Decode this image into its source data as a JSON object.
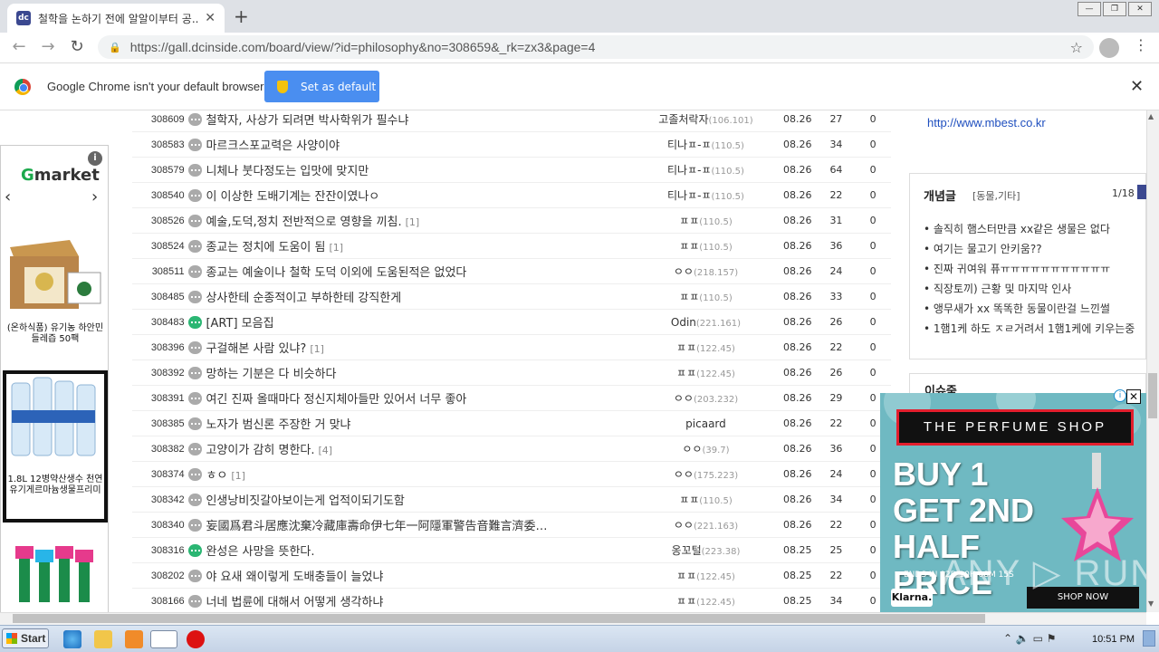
{
  "browser": {
    "tab_title": "철학을 논하기 전에 알알이부터 공...",
    "tab_close": "✕",
    "new_tab": "+",
    "url": "https://gall.dcinside.com/board/view/?id=philosophy&no=308659&_rk=zx3&page=4",
    "win_buttons": [
      "—",
      "❐",
      "✕"
    ]
  },
  "infobar": {
    "text": "Google Chrome isn't your default browser",
    "button": "Set as default",
    "close": "✕"
  },
  "left_ad": {
    "brand": "Gmarket",
    "prev": "‹",
    "next": "›",
    "info": "i",
    "products": [
      "(온하식품) 유기농 하안민들레즙 50팩",
      "1.8L 12병약산생수 천연유기게르마늄생물프리미"
    ]
  },
  "posts": [
    {
      "no": "308609",
      "icon": "text",
      "subject": "철학자, 사상가 되려면 박사학위가 필수냐",
      "comments": "",
      "writer": "고졸처락자",
      "ip": "(106.101)",
      "date": "08.26",
      "hits": "27",
      "rec": "0"
    },
    {
      "no": "308583",
      "icon": "text",
      "subject": "마르크스포교력은 사양이야",
      "comments": "",
      "writer": "티나ㅍ-ㅍ",
      "ip": "(110.5)",
      "date": "08.26",
      "hits": "34",
      "rec": "0"
    },
    {
      "no": "308579",
      "icon": "text",
      "subject": "니체나 붓다정도는 입맛에 맞지만",
      "comments": "",
      "writer": "티나ㅍ-ㅍ",
      "ip": "(110.5)",
      "date": "08.26",
      "hits": "64",
      "rec": "0"
    },
    {
      "no": "308540",
      "icon": "text",
      "subject": "이 이상한 도배기계는 잔잔이였나ㅇ",
      "comments": "",
      "writer": "티나ㅍ-ㅍ",
      "ip": "(110.5)",
      "date": "08.26",
      "hits": "22",
      "rec": "0"
    },
    {
      "no": "308526",
      "icon": "text",
      "subject": "예술,도덕,정치 전반적으로 영향을 끼침.",
      "comments": "[1]",
      "writer": "ㅍㅍ",
      "ip": "(110.5)",
      "date": "08.26",
      "hits": "31",
      "rec": "0"
    },
    {
      "no": "308524",
      "icon": "text",
      "subject": "종교는 정치에 도움이 됨",
      "comments": "[1]",
      "writer": "ㅍㅍ",
      "ip": "(110.5)",
      "date": "08.26",
      "hits": "36",
      "rec": "0"
    },
    {
      "no": "308511",
      "icon": "text",
      "subject": "종교는 예술이나 철학 도덕 이외에 도움된적은 없었다",
      "comments": "",
      "writer": "ㅇㅇ",
      "ip": "(218.157)",
      "date": "08.26",
      "hits": "24",
      "rec": "0"
    },
    {
      "no": "308485",
      "icon": "text",
      "subject": "상사한테 순종적이고 부하한테 강직한게",
      "comments": "",
      "writer": "ㅍㅍ",
      "ip": "(110.5)",
      "date": "08.26",
      "hits": "33",
      "rec": "0"
    },
    {
      "no": "308483",
      "icon": "picture",
      "subject": "[ART] 모음집",
      "comments": "",
      "writer": "Odin",
      "ip": "(221.161)",
      "date": "08.26",
      "hits": "26",
      "rec": "0"
    },
    {
      "no": "308396",
      "icon": "text",
      "subject": "구걸해본 사람 있냐?",
      "comments": "[1]",
      "writer": "ㅍㅍ",
      "ip": "(122.45)",
      "date": "08.26",
      "hits": "22",
      "rec": "0"
    },
    {
      "no": "308392",
      "icon": "text",
      "subject": "망하는 기분은 다 비슷하다",
      "comments": "",
      "writer": "ㅍㅍ",
      "ip": "(122.45)",
      "date": "08.26",
      "hits": "26",
      "rec": "0"
    },
    {
      "no": "308391",
      "icon": "text",
      "subject": "여긴 진짜 올때마다 정신지체아들만 있어서 너무 좋아",
      "comments": "",
      "writer": "ㅇㅇ",
      "ip": "(203.232)",
      "date": "08.26",
      "hits": "29",
      "rec": "0"
    },
    {
      "no": "308385",
      "icon": "text",
      "subject": "노자가 범신론 주장한 거 맞냐",
      "comments": "",
      "writer": "picaard",
      "ip": "",
      "date": "08.26",
      "hits": "22",
      "rec": "0"
    },
    {
      "no": "308382",
      "icon": "text",
      "subject": "고양이가 감히 명한다.",
      "comments": "[4]",
      "writer": "ㅇㅇ",
      "ip": "(39.7)",
      "date": "08.26",
      "hits": "36",
      "rec": "0"
    },
    {
      "no": "308374",
      "icon": "text",
      "subject": "ㅎㅇ",
      "comments": "[1]",
      "writer": "ㅇㅇ",
      "ip": "(175.223)",
      "date": "08.26",
      "hits": "24",
      "rec": "0"
    },
    {
      "no": "308342",
      "icon": "text",
      "subject": "인생낭비짓갈아보이는게 업적이되기도함",
      "comments": "",
      "writer": "ㅍㅍ",
      "ip": "(110.5)",
      "date": "08.26",
      "hits": "34",
      "rec": "0"
    },
    {
      "no": "308340",
      "icon": "text",
      "subject": "妄國爲君斗居應沈棄冷藏庫壽命伊七年一阿隱軍警告音難言濟委…",
      "comments": "",
      "writer": "ㅇㅇ",
      "ip": "(221.163)",
      "date": "08.26",
      "hits": "22",
      "rec": "0"
    },
    {
      "no": "308316",
      "icon": "picture",
      "subject": "완성은 사망을 뜻한다.",
      "comments": "",
      "writer": "옹꼬털",
      "ip": "(223.38)",
      "date": "08.25",
      "hits": "25",
      "rec": "0"
    },
    {
      "no": "308202",
      "icon": "text",
      "subject": "야 요새 왜이렇게 도배충들이 늘었냐",
      "comments": "",
      "writer": "ㅍㅍ",
      "ip": "(122.45)",
      "date": "08.25",
      "hits": "22",
      "rec": "0"
    },
    {
      "no": "308166",
      "icon": "text",
      "subject": "너네 법륜에 대해서 어떻게 생각하냐",
      "comments": "",
      "writer": "ㅍㅍ",
      "ip": "(122.45)",
      "date": "08.25",
      "hits": "34",
      "rec": "0"
    }
  ],
  "sidebar": {
    "link": "http://www.mbest.co.kr",
    "box_title": "개념글",
    "box_sub": "[동물,기타]",
    "page": "1/18",
    "items": [
      "• 솔직히 햄스터만큼 xx같은 생물은 없다",
      "• 여기는 물고기 안키움??",
      "• 진짜 귀여워 퓨ㅠㅠㅠㅠㅠㅠㅠㅠㅠㅠㅠ",
      "• 직장토끼) 근황 및 마지막 인사",
      "• 앵무새가 xx 똑똑한 동물이란걸 느낀썰",
      "• 1햄1케 하도 ㅈㄹ거려서 1햄1케에 키우는중"
    ],
    "box2_title": "이슈줌"
  },
  "perfume_ad": {
    "shop": "THE PERFUME SHOP",
    "headline": "BUY 1 GET 2ND HALF PRICE",
    "ends": "ENDS IN 02D 10H 08M 15S",
    "klarna": "Klarna.",
    "cta": "SHOP NOW",
    "close": "✕",
    "info": "i",
    "watermark": "ANY ▷ RUN"
  },
  "taskbar": {
    "start": "Start",
    "clock": "10:51 PM"
  },
  "colors": {
    "accent": "#3b4890",
    "button_blue": "#4a8ef0",
    "picture_icon": "#2bb673"
  }
}
